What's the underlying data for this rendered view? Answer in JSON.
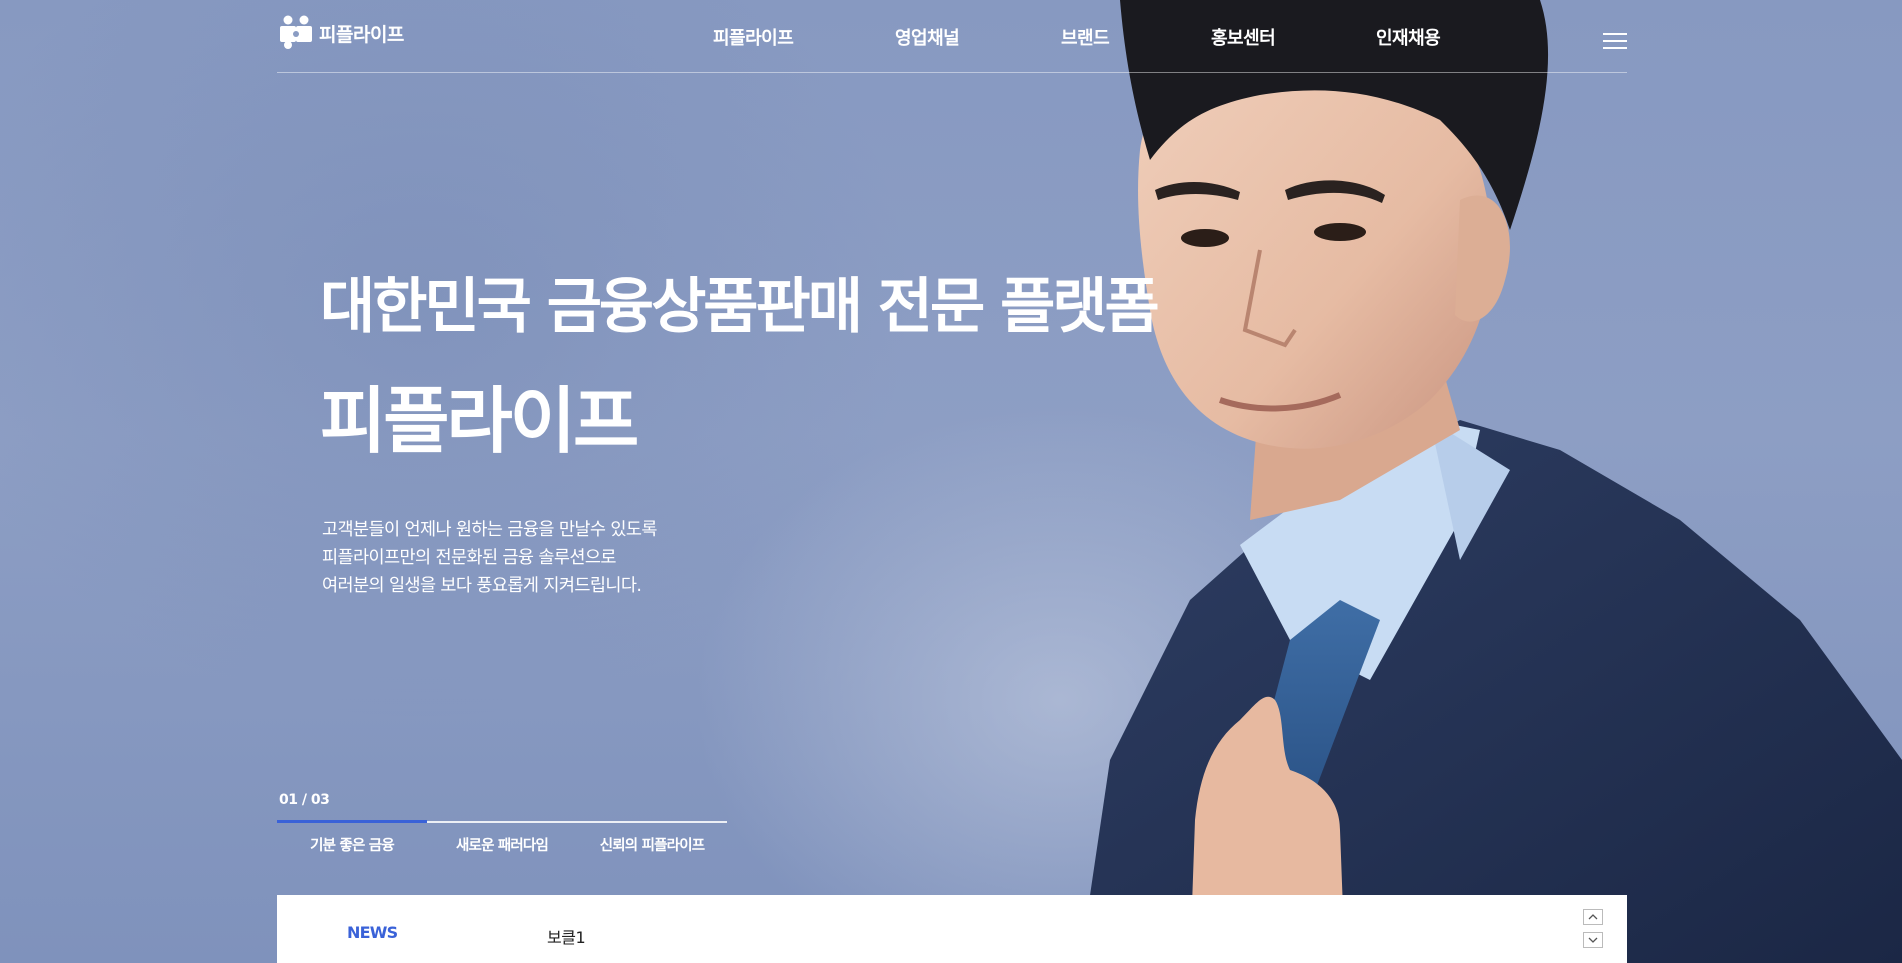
{
  "header": {
    "logo_text": "피플라이프",
    "logo_icon": "puzzle-people-icon",
    "nav": [
      {
        "label": "피플라이프"
      },
      {
        "label": "영업채널"
      },
      {
        "label": "브랜드"
      },
      {
        "label": "홍보센터"
      },
      {
        "label": "인재채용"
      }
    ],
    "menu_icon": "hamburger-icon"
  },
  "hero": {
    "title_line1": "대한민국 금융상품판매 전문 플랫폼",
    "title_line2": "피플라이프",
    "desc": [
      "고객분들이 언제나 원하는 금융을 만날수 있도록",
      "피플라이프만의 전문화된 금융 솔루션으로",
      "여러분의 일생을 보다 풍요롭게 지켜드립니다."
    ]
  },
  "slider": {
    "counter": "01 / 03",
    "progress": 0.333,
    "tabs": [
      {
        "label": "기분 좋은 금융"
      },
      {
        "label": "새로운 패러다임"
      },
      {
        "label": "신뢰의 피플라이프"
      }
    ],
    "active_tab": 0
  },
  "news": {
    "label": "NEWS",
    "item": "보클1",
    "up_icon": "chevron-up-icon",
    "down_icon": "chevron-down-icon"
  },
  "colors": {
    "accent": "#3a62d8",
    "background": "#8a9cc3",
    "text": "#ffffff"
  }
}
